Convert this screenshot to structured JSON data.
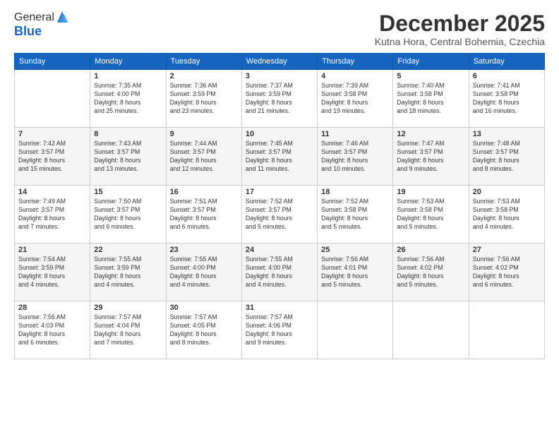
{
  "logo": {
    "general": "General",
    "blue": "Blue"
  },
  "header": {
    "title": "December 2025",
    "subtitle": "Kutna Hora, Central Bohemia, Czechia"
  },
  "weekdays": [
    "Sunday",
    "Monday",
    "Tuesday",
    "Wednesday",
    "Thursday",
    "Friday",
    "Saturday"
  ],
  "weeks": [
    [
      {
        "day": "",
        "info": ""
      },
      {
        "day": "1",
        "info": "Sunrise: 7:35 AM\nSunset: 4:00 PM\nDaylight: 8 hours\nand 25 minutes."
      },
      {
        "day": "2",
        "info": "Sunrise: 7:36 AM\nSunset: 3:59 PM\nDaylight: 8 hours\nand 23 minutes."
      },
      {
        "day": "3",
        "info": "Sunrise: 7:37 AM\nSunset: 3:59 PM\nDaylight: 8 hours\nand 21 minutes."
      },
      {
        "day": "4",
        "info": "Sunrise: 7:39 AM\nSunset: 3:58 PM\nDaylight: 8 hours\nand 19 minutes."
      },
      {
        "day": "5",
        "info": "Sunrise: 7:40 AM\nSunset: 3:58 PM\nDaylight: 8 hours\nand 18 minutes."
      },
      {
        "day": "6",
        "info": "Sunrise: 7:41 AM\nSunset: 3:58 PM\nDaylight: 8 hours\nand 16 minutes."
      }
    ],
    [
      {
        "day": "7",
        "info": "Sunrise: 7:42 AM\nSunset: 3:57 PM\nDaylight: 8 hours\nand 15 minutes."
      },
      {
        "day": "8",
        "info": "Sunrise: 7:43 AM\nSunset: 3:57 PM\nDaylight: 8 hours\nand 13 minutes."
      },
      {
        "day": "9",
        "info": "Sunrise: 7:44 AM\nSunset: 3:57 PM\nDaylight: 8 hours\nand 12 minutes."
      },
      {
        "day": "10",
        "info": "Sunrise: 7:45 AM\nSunset: 3:57 PM\nDaylight: 8 hours\nand 11 minutes."
      },
      {
        "day": "11",
        "info": "Sunrise: 7:46 AM\nSunset: 3:57 PM\nDaylight: 8 hours\nand 10 minutes."
      },
      {
        "day": "12",
        "info": "Sunrise: 7:47 AM\nSunset: 3:57 PM\nDaylight: 8 hours\nand 9 minutes."
      },
      {
        "day": "13",
        "info": "Sunrise: 7:48 AM\nSunset: 3:57 PM\nDaylight: 8 hours\nand 8 minutes."
      }
    ],
    [
      {
        "day": "14",
        "info": "Sunrise: 7:49 AM\nSunset: 3:57 PM\nDaylight: 8 hours\nand 7 minutes."
      },
      {
        "day": "15",
        "info": "Sunrise: 7:50 AM\nSunset: 3:57 PM\nDaylight: 8 hours\nand 6 minutes."
      },
      {
        "day": "16",
        "info": "Sunrise: 7:51 AM\nSunset: 3:57 PM\nDaylight: 8 hours\nand 6 minutes."
      },
      {
        "day": "17",
        "info": "Sunrise: 7:52 AM\nSunset: 3:57 PM\nDaylight: 8 hours\nand 5 minutes."
      },
      {
        "day": "18",
        "info": "Sunrise: 7:52 AM\nSunset: 3:58 PM\nDaylight: 8 hours\nand 5 minutes."
      },
      {
        "day": "19",
        "info": "Sunrise: 7:53 AM\nSunset: 3:58 PM\nDaylight: 8 hours\nand 5 minutes."
      },
      {
        "day": "20",
        "info": "Sunrise: 7:53 AM\nSunset: 3:58 PM\nDaylight: 8 hours\nand 4 minutes."
      }
    ],
    [
      {
        "day": "21",
        "info": "Sunrise: 7:54 AM\nSunset: 3:59 PM\nDaylight: 8 hours\nand 4 minutes."
      },
      {
        "day": "22",
        "info": "Sunrise: 7:55 AM\nSunset: 3:59 PM\nDaylight: 8 hours\nand 4 minutes."
      },
      {
        "day": "23",
        "info": "Sunrise: 7:55 AM\nSunset: 4:00 PM\nDaylight: 8 hours\nand 4 minutes."
      },
      {
        "day": "24",
        "info": "Sunrise: 7:55 AM\nSunset: 4:00 PM\nDaylight: 8 hours\nand 4 minutes."
      },
      {
        "day": "25",
        "info": "Sunrise: 7:56 AM\nSunset: 4:01 PM\nDaylight: 8 hours\nand 5 minutes."
      },
      {
        "day": "26",
        "info": "Sunrise: 7:56 AM\nSunset: 4:02 PM\nDaylight: 8 hours\nand 5 minutes."
      },
      {
        "day": "27",
        "info": "Sunrise: 7:56 AM\nSunset: 4:02 PM\nDaylight: 8 hours\nand 6 minutes."
      }
    ],
    [
      {
        "day": "28",
        "info": "Sunrise: 7:56 AM\nSunset: 4:03 PM\nDaylight: 8 hours\nand 6 minutes."
      },
      {
        "day": "29",
        "info": "Sunrise: 7:57 AM\nSunset: 4:04 PM\nDaylight: 8 hours\nand 7 minutes."
      },
      {
        "day": "30",
        "info": "Sunrise: 7:57 AM\nSunset: 4:05 PM\nDaylight: 8 hours\nand 8 minutes."
      },
      {
        "day": "31",
        "info": "Sunrise: 7:57 AM\nSunset: 4:06 PM\nDaylight: 8 hours\nand 9 minutes."
      },
      {
        "day": "",
        "info": ""
      },
      {
        "day": "",
        "info": ""
      },
      {
        "day": "",
        "info": ""
      }
    ]
  ]
}
